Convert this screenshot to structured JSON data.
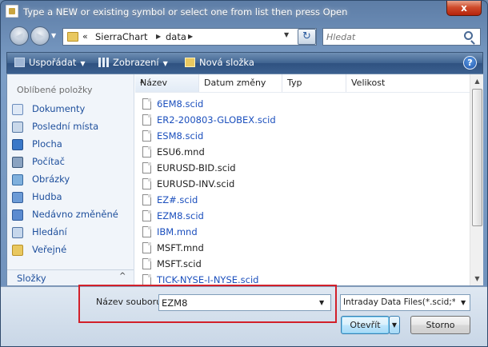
{
  "window": {
    "title": "Type a NEW or existing symbol or select one from list then press Open",
    "close_glyph": "x"
  },
  "nav": {
    "address_sep": "«",
    "breadcrumb": [
      "SierraChart",
      "data"
    ],
    "search_placeholder": "Hledat"
  },
  "toolbar": {
    "organize": "Uspořádat",
    "views": "Zobrazení",
    "new_folder": "Nová složka",
    "help": "?"
  },
  "sidebar": {
    "heading": "Oblíbené položky",
    "items": [
      {
        "label": "Dokumenty",
        "icon": "documents-icon"
      },
      {
        "label": "Poslední místa",
        "icon": "recent-places-icon"
      },
      {
        "label": "Plocha",
        "icon": "desktop-icon"
      },
      {
        "label": "Počítač",
        "icon": "computer-icon"
      },
      {
        "label": "Obrázky",
        "icon": "pictures-icon"
      },
      {
        "label": "Hudba",
        "icon": "music-icon"
      },
      {
        "label": "Nedávno změněné",
        "icon": "recently-changed-icon"
      },
      {
        "label": "Hledání",
        "icon": "searches-icon"
      },
      {
        "label": "Veřejné",
        "icon": "public-folder-icon"
      }
    ],
    "folders_label": "Složky",
    "folders_caret": "^"
  },
  "columns": [
    "Název",
    "Datum změny",
    "Typ",
    "Velikost"
  ],
  "files": [
    {
      "name": "6EM8.scid",
      "color": "#1b4fbd"
    },
    {
      "name": "ER2-200803-GLOBEX.scid",
      "color": "#1b4fbd"
    },
    {
      "name": "ESM8.scid",
      "color": "#1b4fbd"
    },
    {
      "name": "ESU6.mnd",
      "color": "#1e1e1e"
    },
    {
      "name": "EURUSD-BID.scid",
      "color": "#1e1e1e"
    },
    {
      "name": "EURUSD-INV.scid",
      "color": "#1e1e1e"
    },
    {
      "name": "EZ#.scid",
      "color": "#1b4fbd"
    },
    {
      "name": "EZM8.scid",
      "color": "#1b4fbd"
    },
    {
      "name": "IBM.mnd",
      "color": "#1b4fbd"
    },
    {
      "name": "MSFT.mnd",
      "color": "#1e1e1e"
    },
    {
      "name": "MSFT.scid",
      "color": "#1e1e1e"
    },
    {
      "name": "TICK-NYSE-I-NYSE.scid",
      "color": "#1b4fbd"
    }
  ],
  "footer": {
    "filename_label": "Název souboru:",
    "filename_value": "EZM8",
    "filetype_value": "Intraday Data Files(*.scid;*.mnd)",
    "open_label": "Otevřít",
    "cancel_label": "Storno"
  },
  "colors": {
    "highlight_frame": "#d2202a",
    "link_blue": "#1b4fbd",
    "toolbar_blue": "#3f6390"
  }
}
